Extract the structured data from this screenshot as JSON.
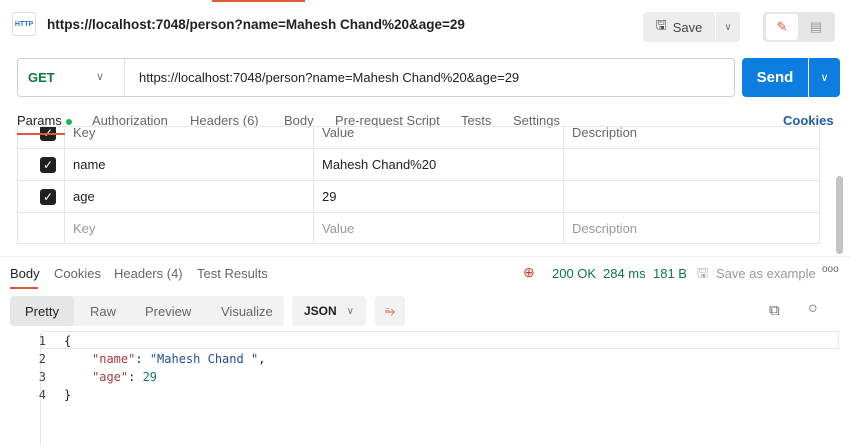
{
  "request": {
    "title": "https://localhost:7048/person?name=Mahesh Chand%20&age=29",
    "icon_label": "HTTP",
    "save_label": "Save",
    "method": "GET",
    "url": "https://localhost:7048/person?name=Mahesh Chand%20&age=29",
    "send_label": "Send"
  },
  "request_tabs": [
    {
      "label": "Params"
    },
    {
      "label": "Authorization"
    },
    {
      "label": "Headers (6)"
    },
    {
      "label": "Body"
    },
    {
      "label": "Pre-request Script"
    },
    {
      "label": "Tests"
    },
    {
      "label": "Settings"
    }
  ],
  "cookies_label": "Cookies",
  "params": {
    "headers": [
      "Key",
      "Value",
      "Description"
    ],
    "rows": [
      {
        "key": "name",
        "value": "Mahesh Chand%20",
        "checked": true
      },
      {
        "key": "age",
        "value": "29",
        "checked": true
      }
    ],
    "placeholders": {
      "key": "Key",
      "value": "Value",
      "description": "Description"
    }
  },
  "response_tabs": [
    {
      "label": "Body"
    },
    {
      "label": "Cookies"
    },
    {
      "label": "Headers (4)"
    },
    {
      "label": "Test Results"
    }
  ],
  "response_status": {
    "status": "200 OK",
    "time": "284 ms",
    "size": "181 B",
    "save_example": "Save as example"
  },
  "view_modes": [
    "Pretty",
    "Raw",
    "Preview",
    "Visualize"
  ],
  "format": "JSON",
  "code": {
    "line_numbers": [
      "1",
      "2",
      "3",
      "4"
    ],
    "open": "{",
    "name_key": "\"name\"",
    "name_val": "\"Mahesh Chand \"",
    "age_key": "\"age\"",
    "age_val": "29",
    "close": "}"
  }
}
